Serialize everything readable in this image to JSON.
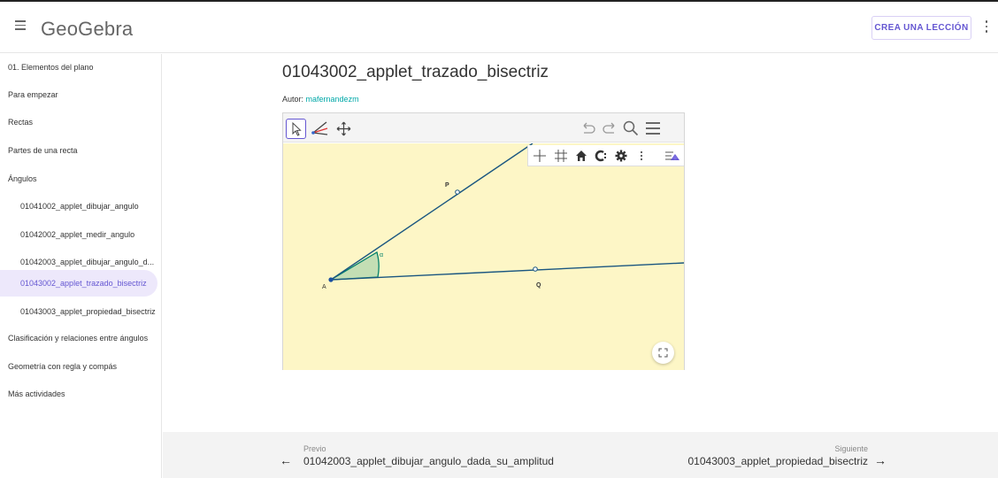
{
  "header": {
    "logo": "GeoGebra",
    "crea_label": "CREA UNA LECCIÓN"
  },
  "sidebar": {
    "items": [
      {
        "label": "01. Elementos del plano"
      },
      {
        "label": "Para empezar"
      },
      {
        "label": "Rectas"
      },
      {
        "label": "Partes de una recta"
      },
      {
        "label": "Ángulos"
      },
      {
        "label": "01041002_applet_dibujar_angulo"
      },
      {
        "label": "01042002_applet_medir_angulo"
      },
      {
        "label": "01042003_applet_dibujar_angulo_d..."
      },
      {
        "label": "01043002_applet_trazado_bisectriz"
      },
      {
        "label": "01043003_applet_propiedad_bisectriz"
      },
      {
        "label": "Clasificación y relaciones entre ángulos"
      },
      {
        "label": "Geometría con regla y compás"
      },
      {
        "label": "Más actividades"
      }
    ]
  },
  "main": {
    "title": "01043002_applet_trazado_bisectriz",
    "author_label": "Autor:",
    "author_name": "mafernandezm"
  },
  "applet": {
    "labels": {
      "P": "P",
      "A": "A",
      "Q": "Q",
      "alpha": "α"
    },
    "colors": {
      "canvas": "#fdf6c6",
      "line": "#1a5680",
      "angle_fill": "#9ccfa9",
      "angle_stroke": "#00806b"
    },
    "tools": [
      "move-tool",
      "angle-bisector-tool",
      "move-graphics-view-tool"
    ]
  },
  "footer": {
    "prev_small": "Previo",
    "prev_title": "01042003_applet_dibujar_angulo_dada_su_amplitud",
    "next_small": "Siguiente",
    "next_title": "01043003_applet_propiedad_bisectriz"
  }
}
